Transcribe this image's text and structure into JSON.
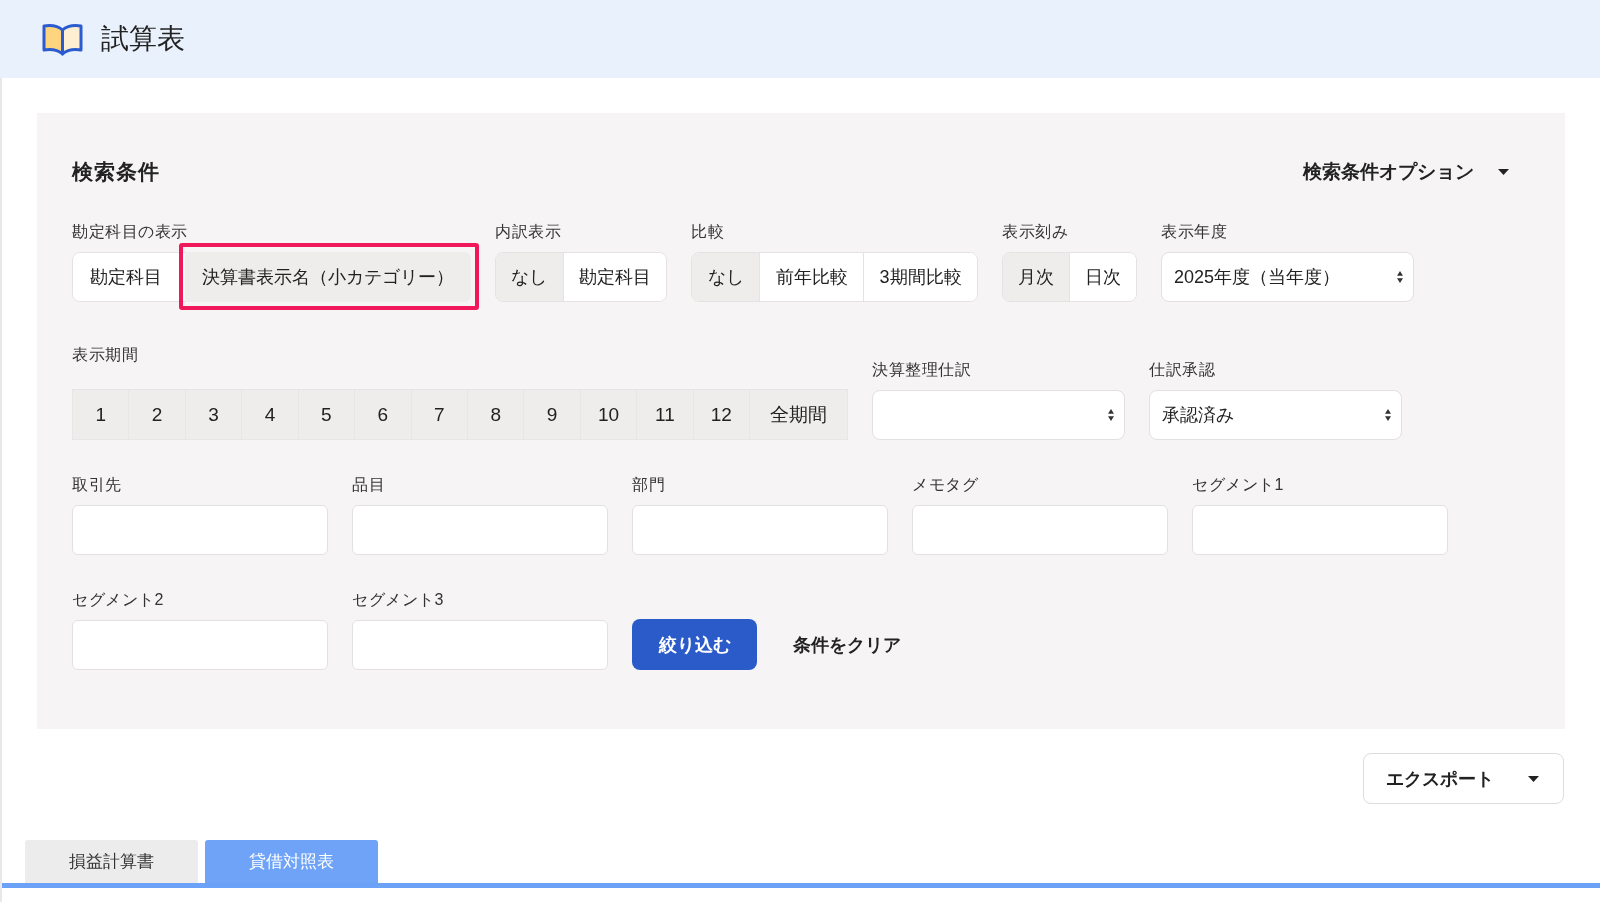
{
  "header": {
    "title": "試算表"
  },
  "search_panel": {
    "title": "検索条件",
    "options_toggle": {
      "label": "検索条件オプション"
    },
    "toggle_groups": [
      {
        "label": "勘定科目の表示",
        "options": [
          {
            "label": "勘定科目",
            "selected": false,
            "highlighted": false
          },
          {
            "label": "決算書表示名（小カテゴリー）",
            "selected": true,
            "highlighted": true
          }
        ]
      },
      {
        "label": "内訳表示",
        "options": [
          {
            "label": "なし",
            "selected": true,
            "highlighted": false
          },
          {
            "label": "勘定科目",
            "selected": false,
            "highlighted": false
          }
        ]
      },
      {
        "label": "比較",
        "options": [
          {
            "label": "なし",
            "selected": true,
            "highlighted": false
          },
          {
            "label": "前年比較",
            "selected": false,
            "highlighted": false
          },
          {
            "label": "3期間比較",
            "selected": false,
            "highlighted": false
          }
        ]
      },
      {
        "label": "表示刻み",
        "options": [
          {
            "label": "月次",
            "selected": true,
            "highlighted": false
          },
          {
            "label": "日次",
            "selected": false,
            "highlighted": false
          }
        ]
      }
    ],
    "fiscal_year": {
      "label": "表示年度",
      "value": "2025年度（当年度）"
    },
    "period": {
      "label": "表示期間",
      "options": [
        {
          "label": "1",
          "selected": true
        },
        {
          "label": "2",
          "selected": true
        },
        {
          "label": "3",
          "selected": true
        },
        {
          "label": "4",
          "selected": true
        },
        {
          "label": "5",
          "selected": true
        },
        {
          "label": "6",
          "selected": true
        },
        {
          "label": "7",
          "selected": true
        },
        {
          "label": "8",
          "selected": true
        },
        {
          "label": "9",
          "selected": true
        },
        {
          "label": "10",
          "selected": true
        },
        {
          "label": "11",
          "selected": true
        },
        {
          "label": "12",
          "selected": true
        },
        {
          "label": "全期間",
          "selected": true
        }
      ]
    },
    "selects": [
      {
        "label": "決算整理仕訳"
      },
      {
        "label": "仕訳承認",
        "value": "承認済み"
      }
    ],
    "text_fields": [
      {
        "label": "取引先"
      },
      {
        "label": "品目"
      },
      {
        "label": "部門"
      },
      {
        "label": "メモタグ"
      },
      {
        "label": "セグメント1"
      },
      {
        "label": "セグメント2"
      },
      {
        "label": "セグメント3"
      }
    ],
    "actions": {
      "submit": "絞り込む",
      "clear": "条件をクリア"
    }
  },
  "export_button": {
    "label": "エクスポート"
  },
  "tabs": [
    {
      "label": "損益計算書",
      "selected": false
    },
    {
      "label": "貸借対照表",
      "selected": true
    }
  ]
}
